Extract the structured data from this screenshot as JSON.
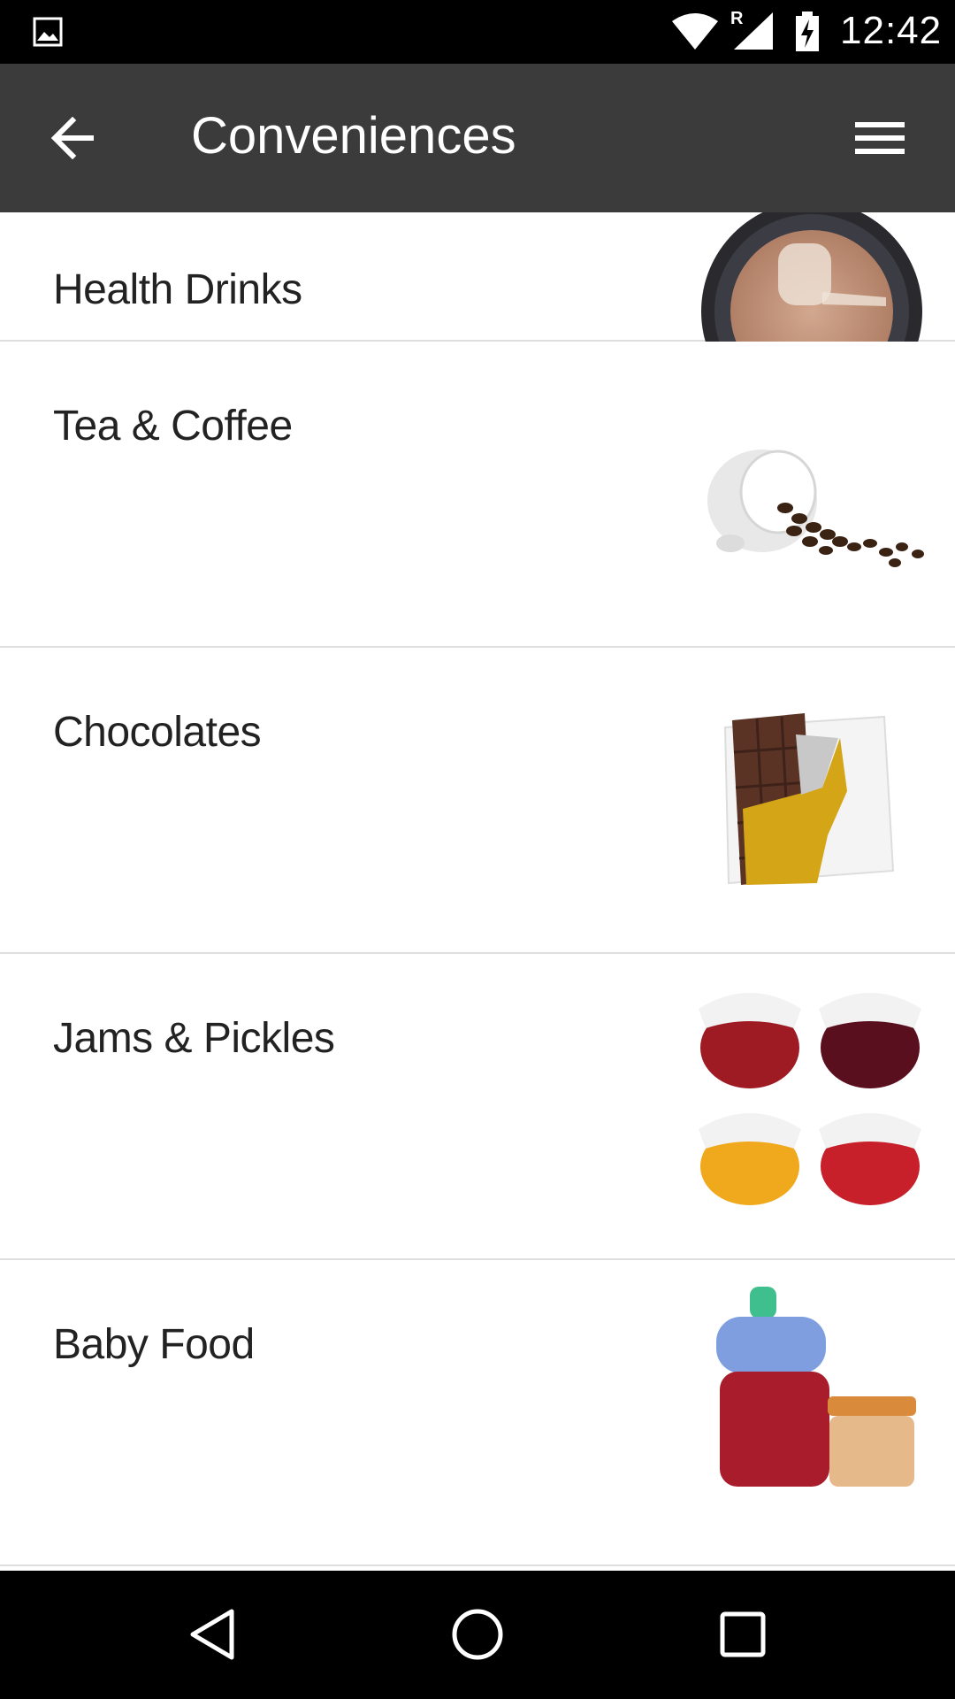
{
  "status_bar": {
    "time": "12:42",
    "roaming": "R",
    "icons": [
      "gallery-icon",
      "wifi-icon",
      "signal-icon",
      "battery-charging-icon"
    ]
  },
  "app_bar": {
    "title": "Conveniences",
    "back_icon": "arrow-left-icon",
    "menu_icon": "hamburger-menu-icon"
  },
  "categories": [
    {
      "label": "Health Drinks",
      "image": "health-drink-powder-image"
    },
    {
      "label": "Tea & Coffee",
      "image": "coffee-cup-beans-image"
    },
    {
      "label": "Chocolates",
      "image": "chocolate-bar-image"
    },
    {
      "label": "Jams & Pickles",
      "image": "jam-jars-image"
    },
    {
      "label": "Baby Food",
      "image": "baby-food-bottle-image"
    }
  ],
  "nav_bar": {
    "buttons": [
      "back-triangle-icon",
      "home-circle-icon",
      "recents-square-icon"
    ]
  },
  "colors": {
    "app_bar": "#3b3b3b",
    "status_bar": "#000000",
    "divider": "#dedede",
    "text": "#222222"
  }
}
